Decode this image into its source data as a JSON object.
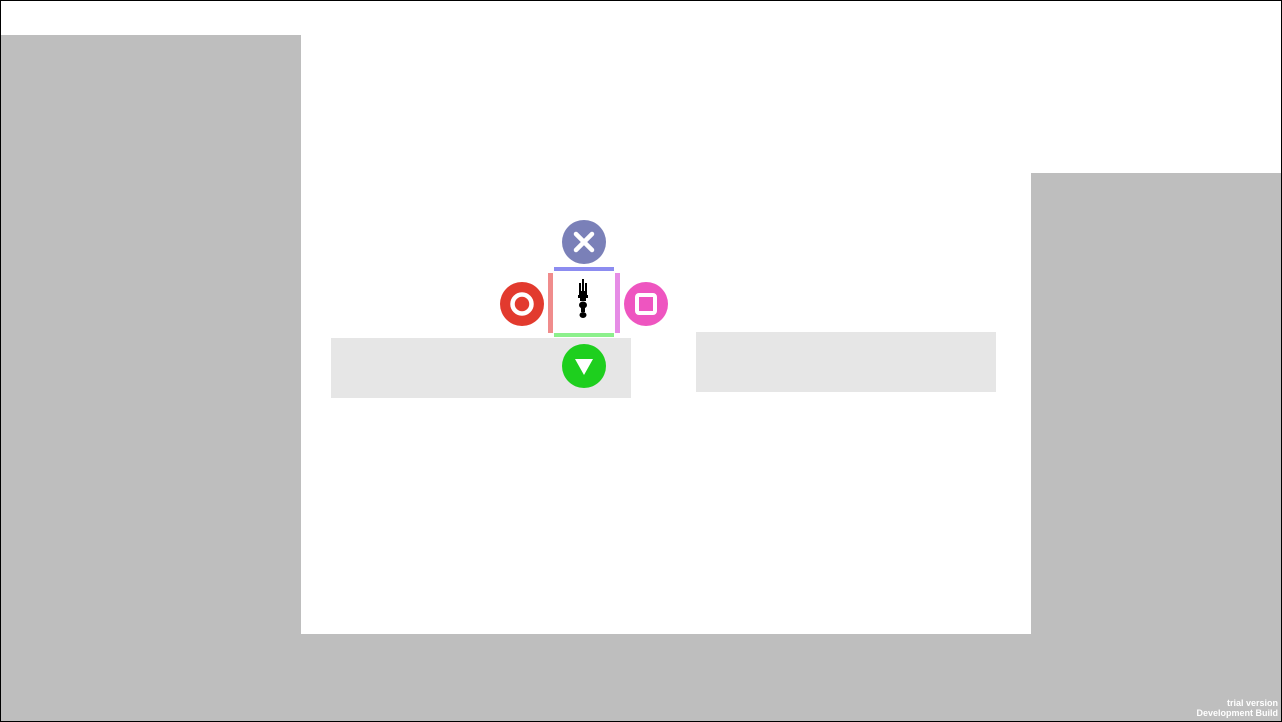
{
  "colors": {
    "wall": "#bebebe",
    "platform": "#e6e6e6",
    "background": "#ffffff",
    "edge_top": "#8c8cf0",
    "edge_left": "#f08c8c",
    "edge_right": "#e68ce6",
    "edge_bottom": "#8cf08c",
    "btn_cross": "#7a80b8",
    "btn_circle": "#e23a2e",
    "btn_square": "#ee55c0",
    "btn_triangle": "#1ecf1e"
  },
  "controls": {
    "top": "cross-icon",
    "left": "circle-icon",
    "right": "square-icon",
    "bottom": "triangle-down-icon"
  },
  "watermark": {
    "line1": "trial version",
    "line2": "Development Build"
  }
}
